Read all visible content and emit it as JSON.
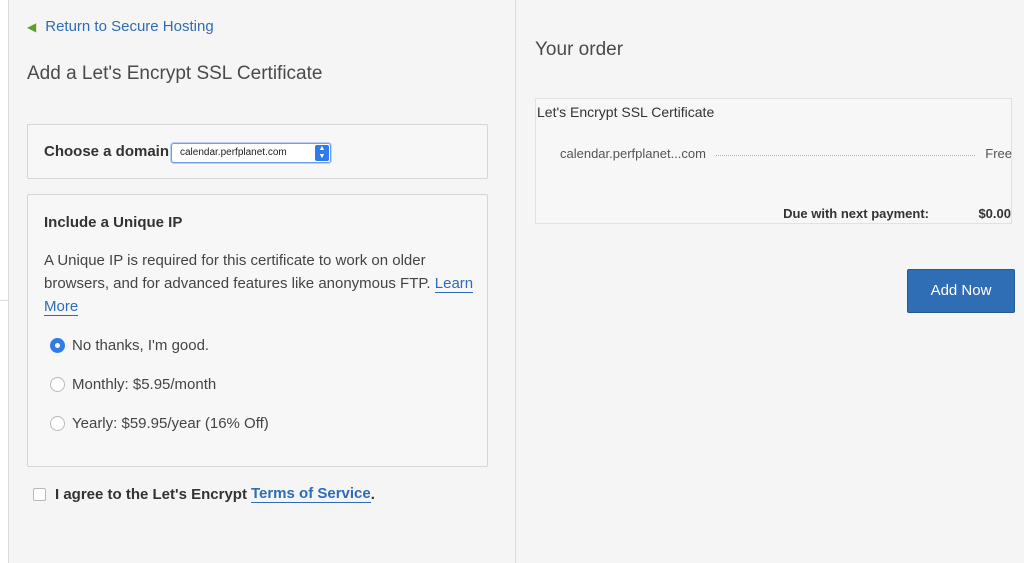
{
  "back_link": {
    "label": "Return to Secure Hosting"
  },
  "page_title": "Add a Let's Encrypt SSL Certificate",
  "domain": {
    "label": "Choose a domain:",
    "selected": "calendar.perfplanet.com"
  },
  "unique_ip": {
    "heading": "Include a Unique IP",
    "description": "A Unique IP is required for this certificate to work on older browsers, and for advanced features like anonymous FTP.",
    "learn_more": "Learn More",
    "options": [
      {
        "label": "No thanks, I'm good.",
        "checked": true
      },
      {
        "label": "Monthly: $5.95/month",
        "checked": false
      },
      {
        "label": "Yearly: $59.95/year (16% Off)",
        "checked": false
      }
    ]
  },
  "agreement": {
    "prefix": "I agree to the Let's Encrypt",
    "link": "Terms of Service",
    "suffix": "."
  },
  "order": {
    "title": "Your order",
    "product": "Let's Encrypt SSL Certificate",
    "line_domain": "calendar.perfplanet...com",
    "line_price": "Free",
    "due_label": "Due with next payment:",
    "due_amount": "$0.00",
    "add_button": "Add Now"
  },
  "colors": {
    "accent": "#2f6db5",
    "link": "#2e6db5",
    "back_arrow": "#5aa02c",
    "panel_bg": "#f5f5f5"
  },
  "icons": {
    "back": "back-arrow-icon",
    "select": "select-stepper-icon"
  }
}
